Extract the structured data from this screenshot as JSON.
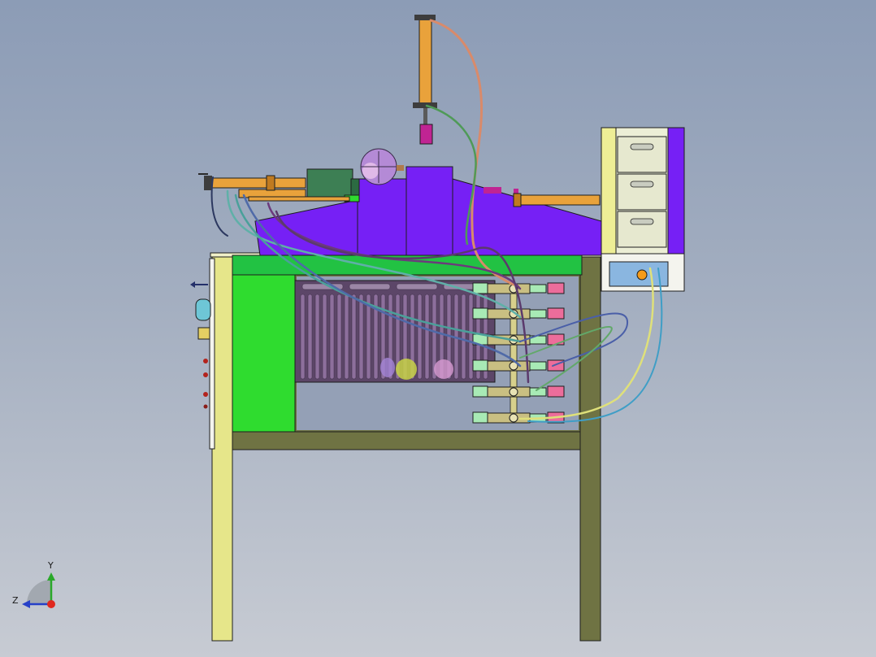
{
  "viewport": {
    "triad": {
      "y_label": "Y",
      "z_label": "Z"
    }
  },
  "colors": {
    "frame_leg": "#e6e68a",
    "frame_rail": "#6f7343",
    "enclosure_panel": "#2fdc2f",
    "top_plate": "#22c243",
    "hood": "#7620f5",
    "cylinder": "#e9a23b",
    "valve_body": "#c9bf82",
    "valve_fitting": "#a8eab5",
    "solenoid": "#ec6d9b",
    "drawer_cabinet": "#eceed6",
    "basin": "#8ab6e0",
    "grille": "#7b5b86",
    "motor": "#3d7f54",
    "sphere": "#b48ad6",
    "ram_cap": "#c02493",
    "background_top": "#8c9cb6",
    "background_bottom": "#c7cbd3"
  },
  "components": [
    "frame",
    "enclosure",
    "top-plate",
    "hood",
    "horizontal-cylinders",
    "vertical-cylinder",
    "valve-manifold",
    "drawer-cabinet",
    "grille-panel",
    "hoses"
  ]
}
